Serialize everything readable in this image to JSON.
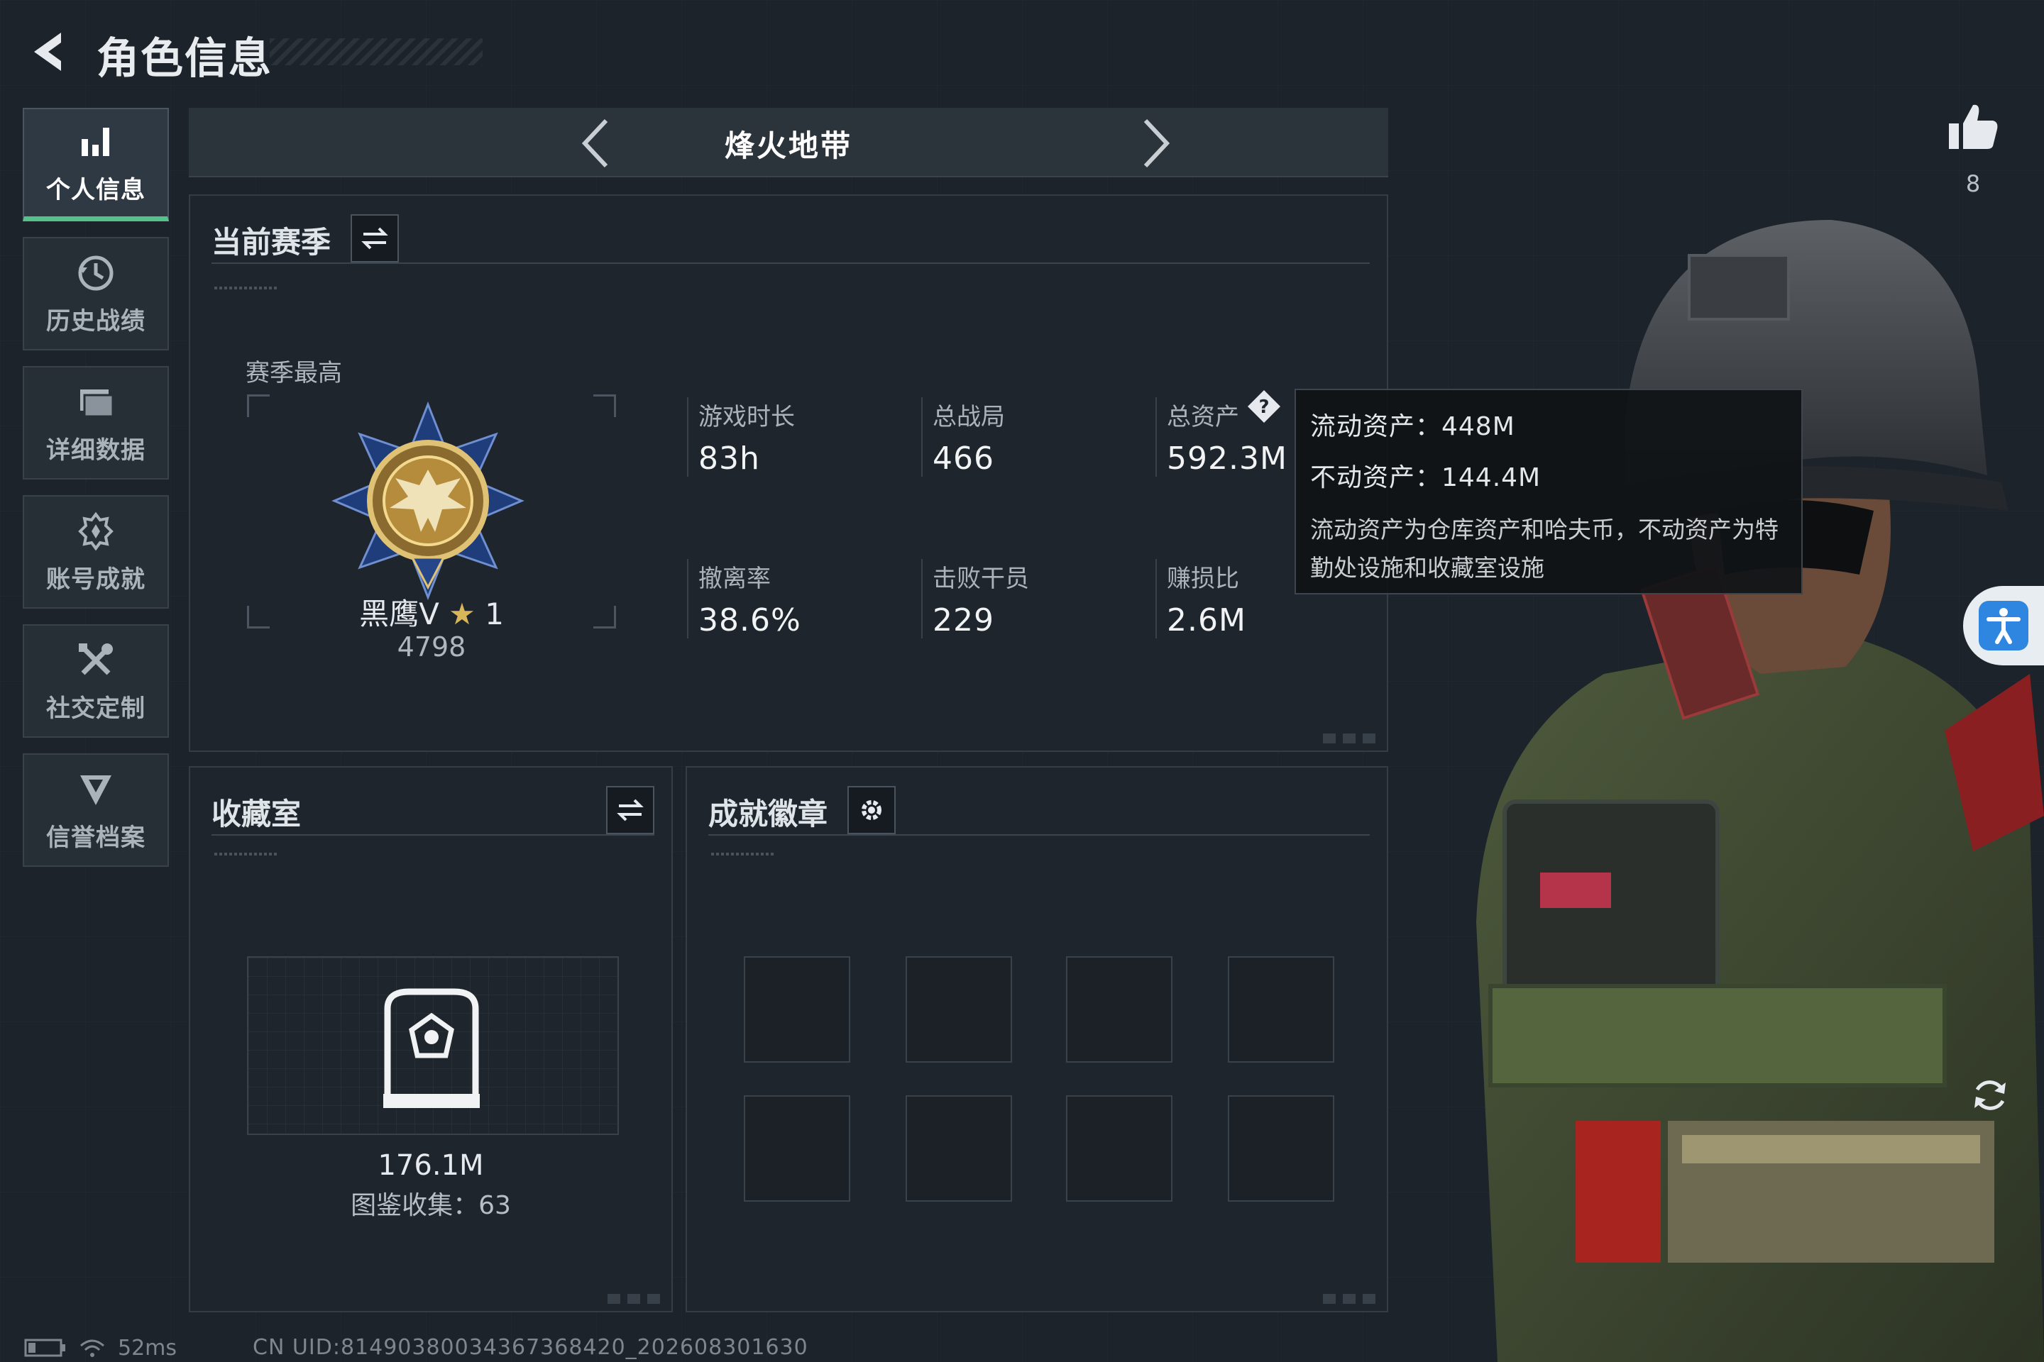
{
  "header": {
    "title": "角色信息"
  },
  "nav": {
    "items": [
      {
        "label": "个人信息",
        "icon": "bar-chart-icon",
        "active": true
      },
      {
        "label": "历史战绩",
        "icon": "history-icon"
      },
      {
        "label": "详细数据",
        "icon": "folder-icon"
      },
      {
        "label": "账号成就",
        "icon": "achievement-icon"
      },
      {
        "label": "社交定制",
        "icon": "tools-icon"
      },
      {
        "label": "信誉档案",
        "icon": "credit-shield-icon"
      }
    ]
  },
  "mode": {
    "title": "烽火地带"
  },
  "season": {
    "title": "当前赛季",
    "best_label": "赛季最高",
    "rank_name": "黑鹰V",
    "rank_stars": "1",
    "rank_score": "4798",
    "stats": [
      {
        "label": "游戏时长",
        "value": "83h"
      },
      {
        "label": "总战局",
        "value": "466"
      },
      {
        "label": "总资产",
        "value": "592.3M"
      },
      {
        "label": "撤离率",
        "value": "38.6%"
      },
      {
        "label": "击败干员",
        "value": "229"
      },
      {
        "label": "赚损比",
        "value": "2.6M"
      }
    ]
  },
  "tooltip": {
    "liquid": "流动资产：448M",
    "fixed": "不动资产：144.4M",
    "desc": "流动资产为仓库资产和哈夫币，不动资产为特勤处设施和收藏室设施"
  },
  "collection": {
    "title": "收藏室",
    "value": "176.1M",
    "count": "图鉴收集：63"
  },
  "badges": {
    "title": "成就徽章"
  },
  "likes": {
    "count": "8"
  },
  "status": {
    "ping": "52ms",
    "uid": "CN UID:814903800343673684​20_202608301630"
  },
  "colors": {
    "accent_green": "#55c28a",
    "background": "#1c232a",
    "panel": "#1e252c",
    "gold": "#d9b65a",
    "access_blue": "#2f86e0"
  }
}
